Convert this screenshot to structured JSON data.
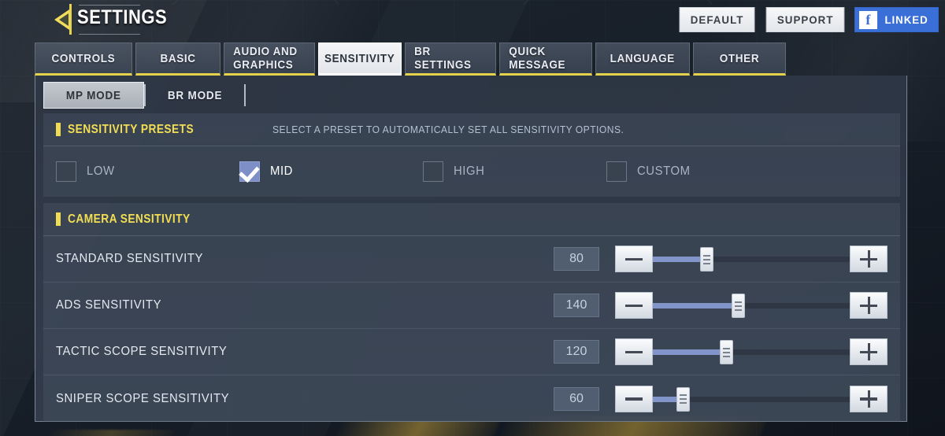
{
  "header": {
    "title": "SETTINGS",
    "back_icon": "back-arrow-icon",
    "buttons": [
      {
        "label": "DEFAULT",
        "name": "default-button"
      },
      {
        "label": "SUPPORT",
        "name": "support-button"
      }
    ],
    "facebook": {
      "icon": "facebook-icon",
      "glyph": "f",
      "label": "LINKED",
      "color": "#3a6fd8"
    }
  },
  "tabs": [
    {
      "label": "CONTROLS",
      "active": false
    },
    {
      "label": "BASIC",
      "active": false
    },
    {
      "label": "AUDIO AND GRAPHICS",
      "active": false
    },
    {
      "label": "SENSITIVITY",
      "active": true
    },
    {
      "label": "BR SETTINGS",
      "active": false
    },
    {
      "label": "QUICK MESSAGE",
      "active": false
    },
    {
      "label": "LANGUAGE",
      "active": false
    },
    {
      "label": "OTHER",
      "active": false
    }
  ],
  "sub_tabs": [
    {
      "label": "MP MODE",
      "active": true
    },
    {
      "label": "BR MODE",
      "active": false
    }
  ],
  "presets_section": {
    "title": "SENSITIVITY PRESETS",
    "hint": "SELECT A PRESET TO AUTOMATICALLY SET ALL SENSITIVITY OPTIONS.",
    "options": [
      {
        "label": "LOW",
        "checked": false
      },
      {
        "label": "MID",
        "checked": true
      },
      {
        "label": "HIGH",
        "checked": false
      },
      {
        "label": "CUSTOM",
        "checked": false
      }
    ]
  },
  "camera_section": {
    "title": "CAMERA SENSITIVITY",
    "rows": [
      {
        "label": "STANDARD SENSITIVITY",
        "value": "80",
        "percent": 27,
        "minus": "−",
        "plus": "+"
      },
      {
        "label": "ADS SENSITIVITY",
        "value": "140",
        "percent": 43,
        "minus": "−",
        "plus": "+"
      },
      {
        "label": "TACTIC SCOPE SENSITIVITY",
        "value": "120",
        "percent": 37,
        "minus": "−",
        "plus": "+"
      },
      {
        "label": "SNIPER SCOPE SENSITIVITY",
        "value": "60",
        "percent": 15,
        "minus": "−",
        "plus": "+"
      }
    ]
  },
  "theme": {
    "accent_yellow": "#f0dc53",
    "slider_blue": "#8195cb",
    "checkbox_blue": "#7d8fc6"
  }
}
